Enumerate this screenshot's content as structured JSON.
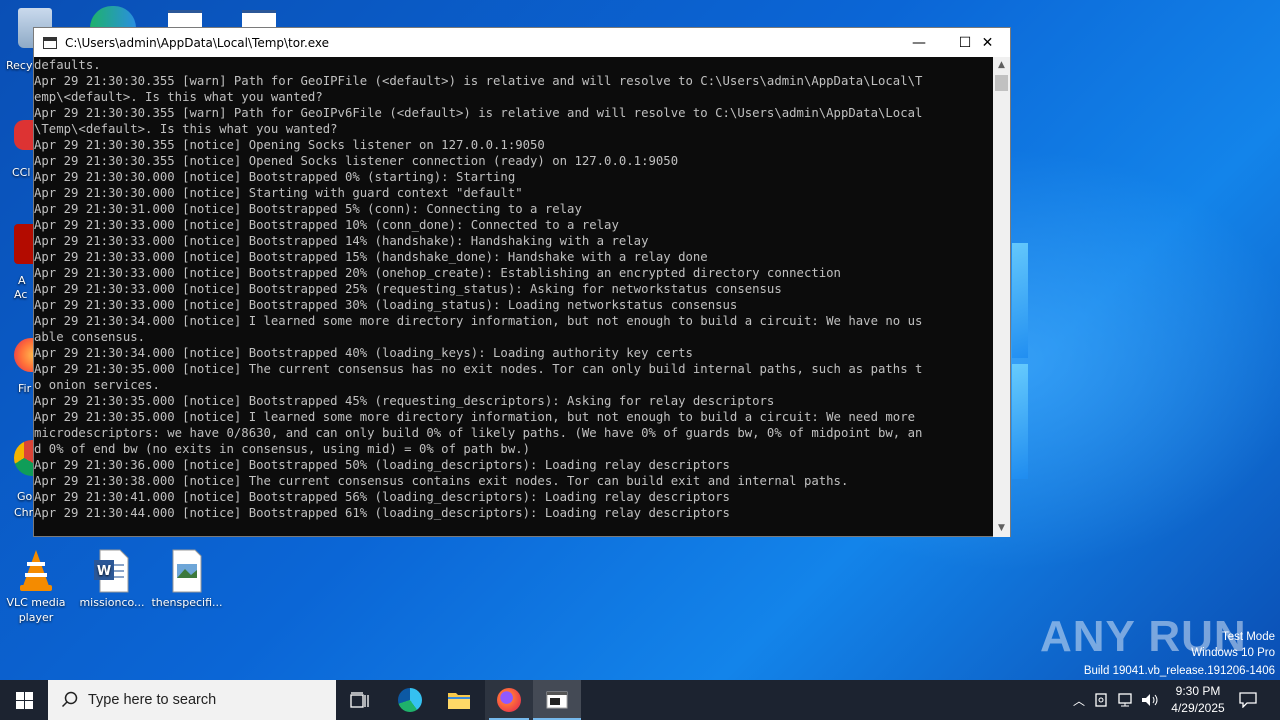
{
  "window": {
    "title": "C:\\Users\\admin\\AppData\\Local\\Temp\\tor.exe",
    "minimize_glyph": "—",
    "maximize_glyph": "☐",
    "close_glyph": "✕"
  },
  "console_lines": [
    "defaults.",
    "Apr 29 21:30:30.355 [warn] Path for GeoIPFile (<default>) is relative and will resolve to C:\\Users\\admin\\AppData\\Local\\T",
    "emp\\<default>. Is this what you wanted?",
    "Apr 29 21:30:30.355 [warn] Path for GeoIPv6File (<default>) is relative and will resolve to C:\\Users\\admin\\AppData\\Local",
    "\\Temp\\<default>. Is this what you wanted?",
    "Apr 29 21:30:30.355 [notice] Opening Socks listener on 127.0.0.1:9050",
    "Apr 29 21:30:30.355 [notice] Opened Socks listener connection (ready) on 127.0.0.1:9050",
    "Apr 29 21:30:30.000 [notice] Bootstrapped 0% (starting): Starting",
    "Apr 29 21:30:30.000 [notice] Starting with guard context \"default\"",
    "Apr 29 21:30:31.000 [notice] Bootstrapped 5% (conn): Connecting to a relay",
    "Apr 29 21:30:33.000 [notice] Bootstrapped 10% (conn_done): Connected to a relay",
    "Apr 29 21:30:33.000 [notice] Bootstrapped 14% (handshake): Handshaking with a relay",
    "Apr 29 21:30:33.000 [notice] Bootstrapped 15% (handshake_done): Handshake with a relay done",
    "Apr 29 21:30:33.000 [notice] Bootstrapped 20% (onehop_create): Establishing an encrypted directory connection",
    "Apr 29 21:30:33.000 [notice] Bootstrapped 25% (requesting_status): Asking for networkstatus consensus",
    "Apr 29 21:30:33.000 [notice] Bootstrapped 30% (loading_status): Loading networkstatus consensus",
    "Apr 29 21:30:34.000 [notice] I learned some more directory information, but not enough to build a circuit: We have no us",
    "able consensus.",
    "Apr 29 21:30:34.000 [notice] Bootstrapped 40% (loading_keys): Loading authority key certs",
    "Apr 29 21:30:35.000 [notice] The current consensus has no exit nodes. Tor can only build internal paths, such as paths t",
    "o onion services.",
    "Apr 29 21:30:35.000 [notice] Bootstrapped 45% (requesting_descriptors): Asking for relay descriptors",
    "Apr 29 21:30:35.000 [notice] I learned some more directory information, but not enough to build a circuit: We need more",
    "microdescriptors: we have 0/8630, and can only build 0% of likely paths. (We have 0% of guards bw, 0% of midpoint bw, an",
    "d 0% of end bw (no exits in consensus, using mid) = 0% of path bw.)",
    "Apr 29 21:30:36.000 [notice] Bootstrapped 50% (loading_descriptors): Loading relay descriptors",
    "Apr 29 21:30:38.000 [notice] The current consensus contains exit nodes. Tor can build exit and internal paths.",
    "Apr 29 21:30:41.000 [notice] Bootstrapped 56% (loading_descriptors): Loading relay descriptors",
    "Apr 29 21:30:44.000 [notice] Bootstrapped 61% (loading_descriptors): Loading relay descriptors"
  ],
  "desktop": {
    "left_labels": [
      "Recy",
      "CCl",
      "A",
      "Ac",
      "Fir",
      "Go",
      "Chr"
    ],
    "icons": [
      {
        "label1": "VLC media",
        "label2": "player"
      },
      {
        "label1": "missionco...",
        "label2": ""
      },
      {
        "label1": "thenspecifi...",
        "label2": ""
      }
    ]
  },
  "watermark": {
    "brand": "ANY RUN",
    "line1": "Test Mode",
    "line2": "Windows 10 Pro",
    "line3": "Build 19041.vb_release.191206-1406"
  },
  "taskbar": {
    "search_placeholder": "Type here to search",
    "time": "9:30 PM",
    "date": "4/29/2025",
    "colors": {
      "bg": "#1c2330",
      "search_bg": "#f2f2f2",
      "active_underline": "#76b9ed"
    }
  }
}
